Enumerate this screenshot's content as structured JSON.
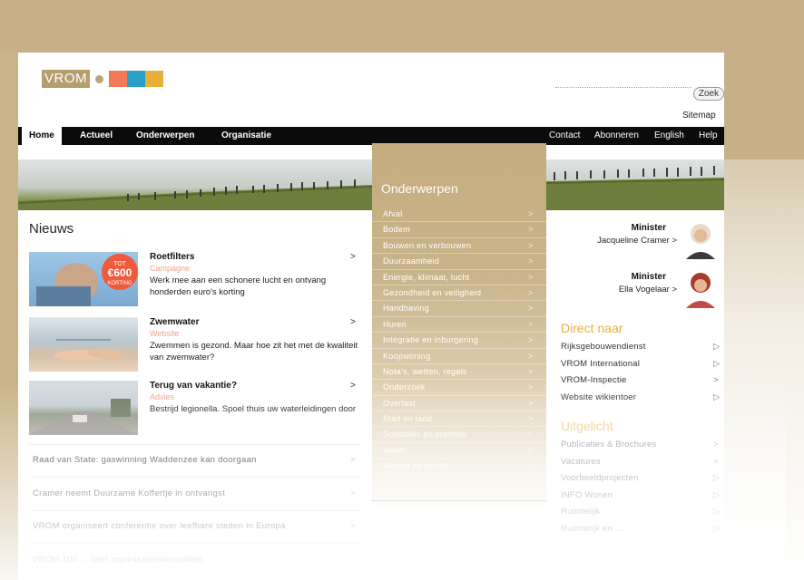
{
  "header": {
    "logo_text": "VROM",
    "logo_colors": [
      "#f07a5a",
      "#2aa0c8",
      "#e8b038"
    ],
    "search_button": "Zoek",
    "sitemap": "Sitemap"
  },
  "nav": {
    "left": [
      "Home",
      "Actueel",
      "Onderwerpen",
      "Organisatie"
    ],
    "right": [
      "Contact",
      "Abonneren",
      "English",
      "Help"
    ]
  },
  "news": {
    "heading": "Nieuws",
    "items": [
      {
        "title": "Roetfilters",
        "category": "Campagne",
        "text": "Werk mee aan een schonere lucht en ontvang honderden euro's korting",
        "badge": "TOT €600 KORTING"
      },
      {
        "title": "Zwemwater",
        "category": "Website",
        "text": "Zwemmen is gezond. Maar hoe zit het met de kwaliteit van zwemwater?"
      },
      {
        "title": "Terug van vakantie?",
        "category": "Advies",
        "text": "Bestrijd legionella. Spoel thuis uw waterleidingen door"
      }
    ],
    "headlines": [
      "Raad van State: gaswinning Waddenzee kan doorgaan",
      "Cramer neemt Duurzame Koffertje in ontvangst",
      "VROM organiseert conferentie over leefbare steden in Europa",
      "VROM 100 ... over organisatieminimaliteit"
    ]
  },
  "topics": {
    "title": "Onderwerpen",
    "items": [
      "Afval",
      "Bodem",
      "Bouwen en verbouwen",
      "Duurzaamheid",
      "Energie, klimaat, lucht",
      "Gezondheid en veiligheid",
      "Handhaving",
      "Huren",
      "Integratie en inburgering",
      "Koopwoning",
      "Nota's, wetten, regels",
      "Onderzoek",
      "Overlast",
      "Stad en land",
      "Subsidies en premies",
      "Water",
      "Wonen en ruimte"
    ]
  },
  "ministers": [
    {
      "role": "Minister",
      "name": "Jacqueline Cramer"
    },
    {
      "role": "Minister",
      "name": "Ella Vogelaar"
    }
  ],
  "direct": {
    "title": "Direct naar",
    "items": [
      "Rijksgebouwendienst",
      "VROM International",
      "VROM-Inspectie",
      "Website wikientoer"
    ]
  },
  "services": {
    "title": "Uitgelicht",
    "items": [
      "Publicaties & Brochures",
      "Vacatures",
      "Voorbeeldprojecten",
      "INFO Wonen",
      "Ruimtelijk",
      "Ruimtelijk en ... "
    ]
  }
}
